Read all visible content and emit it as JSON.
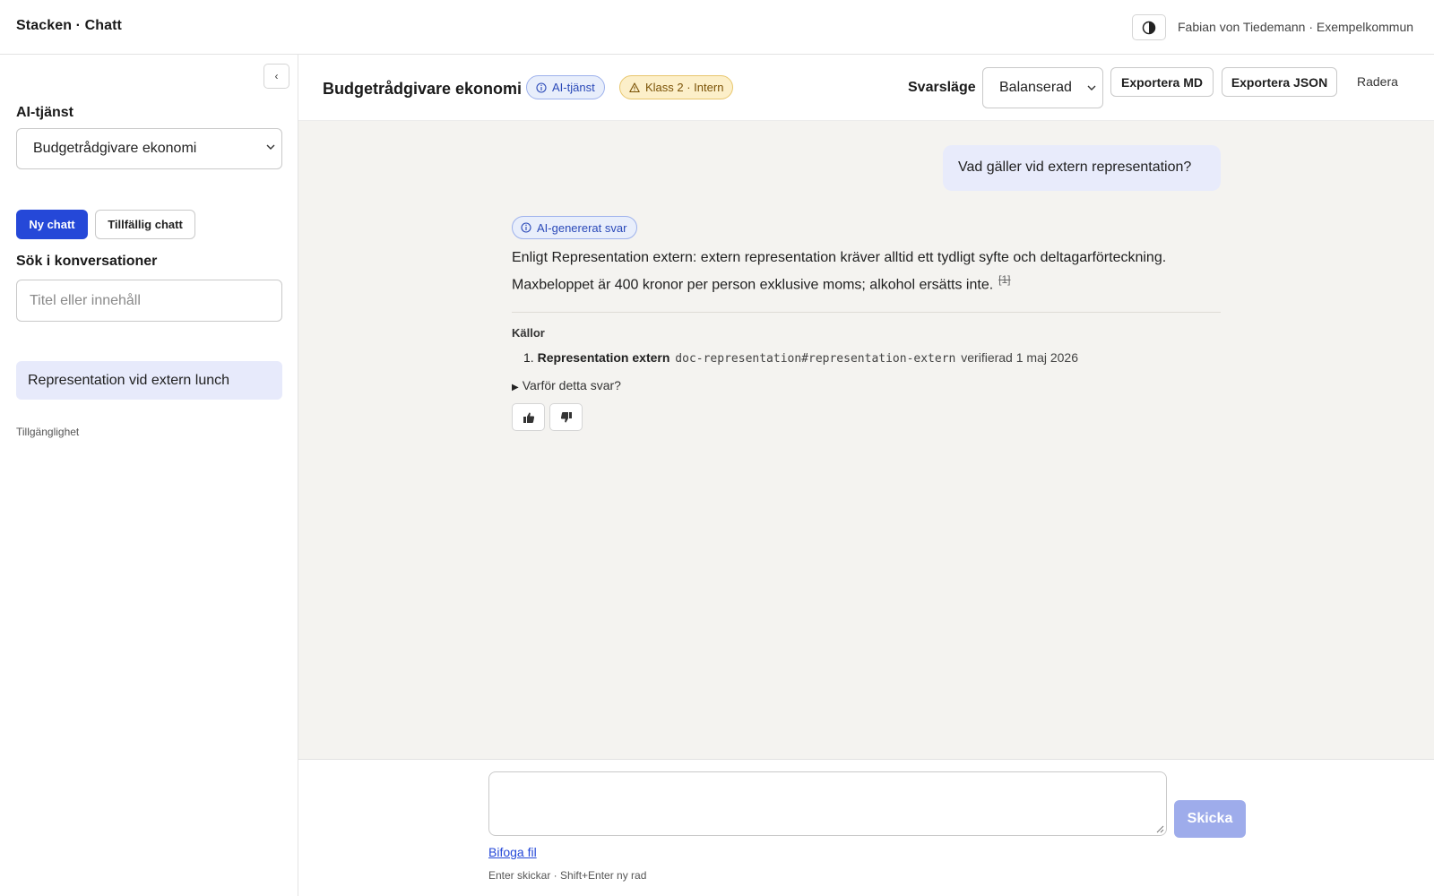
{
  "topbar": {
    "brand": "Stacken · Chatt",
    "user": "Fabian von Tiedemann · Exempelkommun"
  },
  "sidebar": {
    "collapse_label": "‹",
    "service_label": "AI-tjänst",
    "service_value": "Budgetrådgivare ekonomi",
    "new_chat_label": "Ny chatt",
    "temp_chat_label": "Tillfällig chatt",
    "search_label": "Sök i konversationer",
    "search_placeholder": "Titel eller innehåll",
    "conversations": [
      {
        "title": "Representation vid extern lunch"
      }
    ],
    "accessibility_label": "Tillgänglighet"
  },
  "header": {
    "service_title": "Budgetrådgivare ekonomi",
    "ai_badge": "AI-tjänst",
    "class_badge": "Klass 2 · Intern",
    "mode_label": "Svarsläge",
    "mode_value": "Balanserad",
    "export_md": "Exportera MD",
    "export_json": "Exportera JSON",
    "delete": "Radera"
  },
  "chat": {
    "user_message": "Vad gäller vid extern representation?",
    "ai_badge": "AI-genererat svar",
    "answer_text": "Enligt Representation extern: extern representation kräver alltid ett tydligt syfte och deltagarförteckning. Maxbeloppet är 400 kronor per person exklusive moms; alkohol ersätts inte.",
    "citation": "[1]",
    "sources_label": "Källor",
    "sources": [
      {
        "num": "1.",
        "title": "Representation extern",
        "ref": "doc-representation#representation-extern",
        "verified": "verifierad 1 maj 2026"
      }
    ],
    "why_label": "Varför detta svar?"
  },
  "composer": {
    "send_label": "Skicka",
    "attach_label": "Bifoga fil",
    "hint": "Enter skickar · Shift+Enter ny rad"
  },
  "colors": {
    "primary": "#2548d8",
    "primary_disabled": "#9eaceb",
    "chat_bg": "#f4f3f0",
    "user_bubble": "#e8ebfb",
    "warning_badge": "#fcefc9"
  }
}
